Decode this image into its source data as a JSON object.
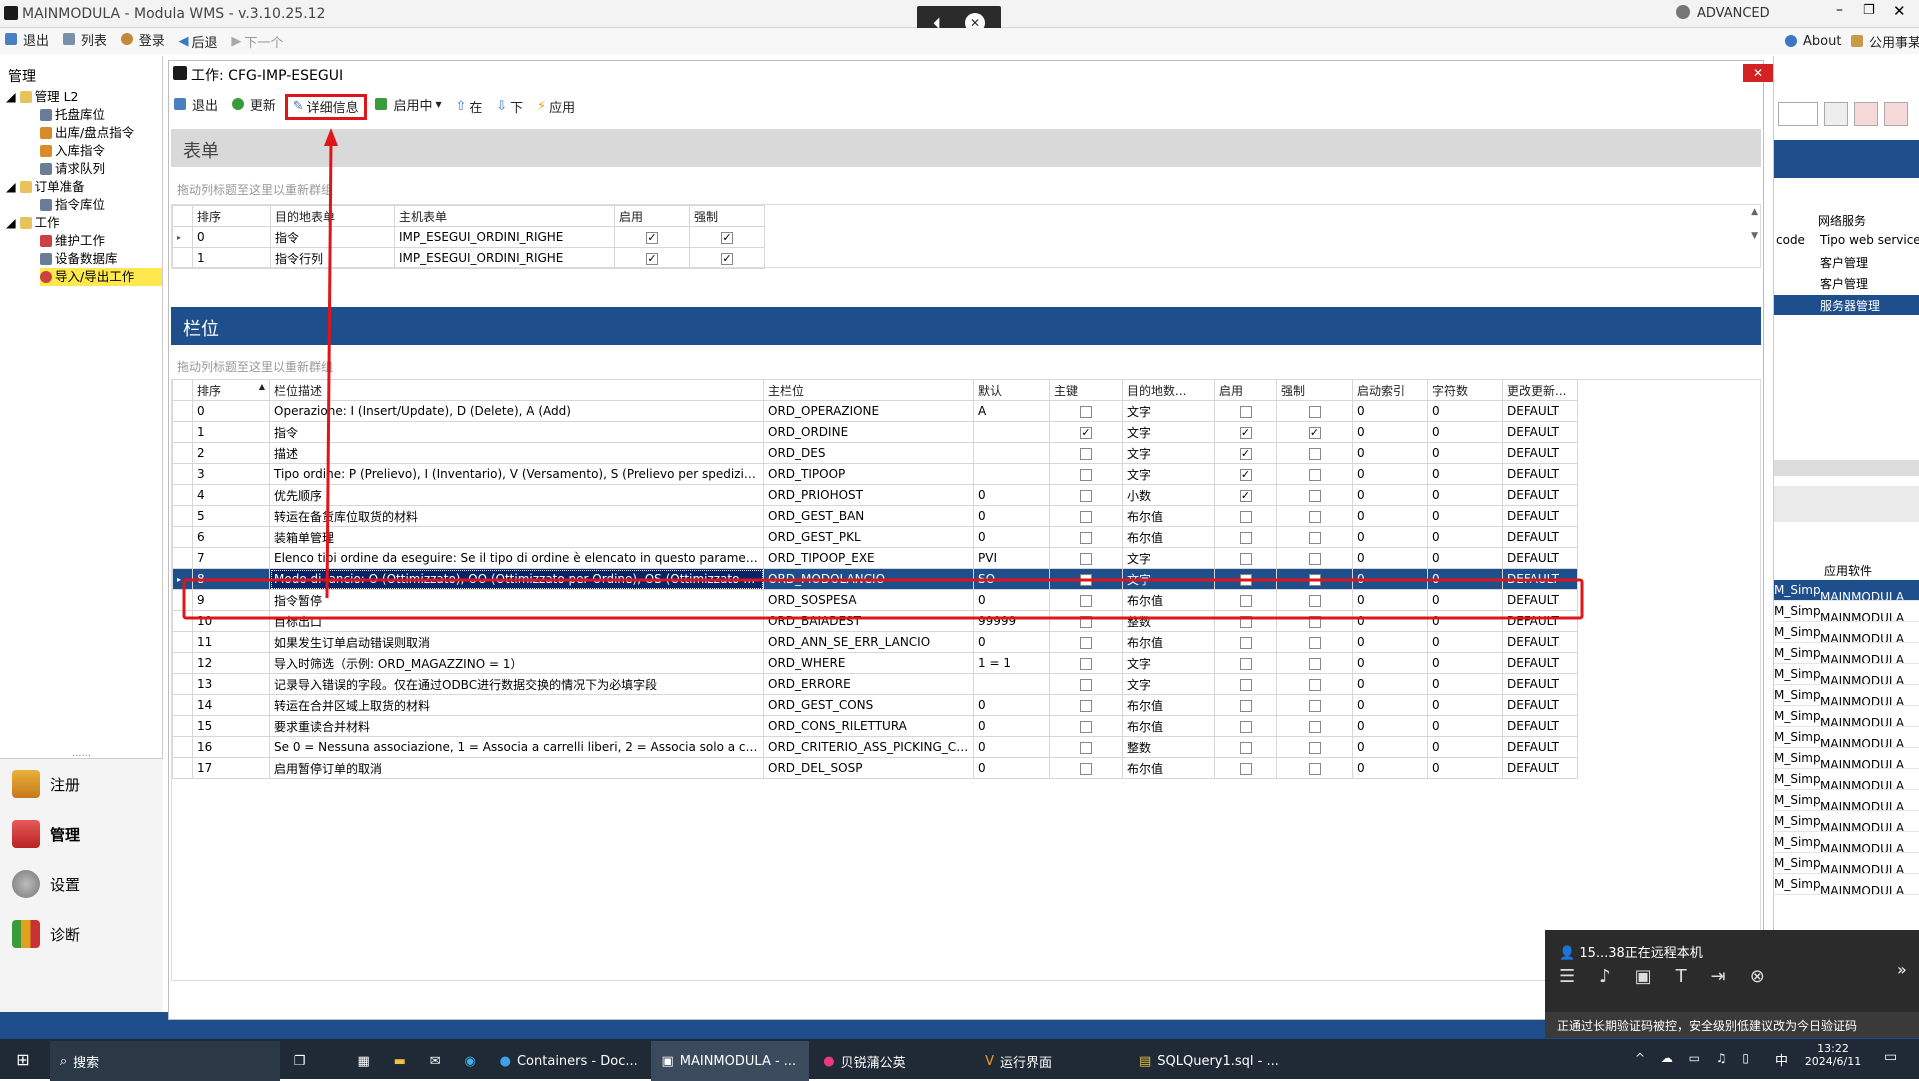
{
  "window": {
    "title": "MAINMODULA - Modula WMS - v.3.10.25.12",
    "user": "ADVANCED"
  },
  "toolbar": {
    "exit": "退出",
    "list": "列表",
    "login": "登录",
    "back": "后退",
    "next": "下一个",
    "about": "About",
    "common": "公用事某"
  },
  "left_panel": {
    "title": "管理",
    "tree": [
      {
        "label": "管理 L2",
        "level": 0
      },
      {
        "label": "托盘库位",
        "level": 1
      },
      {
        "label": "出库/盘点指令",
        "level": 1
      },
      {
        "label": "入库指令",
        "level": 1
      },
      {
        "label": "请求队列",
        "level": 1
      },
      {
        "label": "订单准备",
        "level": 0
      },
      {
        "label": "指令库位",
        "level": 1
      },
      {
        "label": "工作",
        "level": 0
      },
      {
        "label": "维护工作",
        "level": 1
      },
      {
        "label": "设备数据库",
        "level": 1
      },
      {
        "label": "导入/导出工作",
        "level": 1,
        "selected": true
      }
    ],
    "dots": "......",
    "nav": [
      "注册",
      "管理",
      "设置",
      "诊断"
    ]
  },
  "dialog": {
    "title": "工作: CFG-IMP-ESEGUI",
    "toolbar": {
      "exit": "退出",
      "refresh": "更新",
      "details": "详细信息",
      "enabled": "启用中",
      "up": "在",
      "down": "下",
      "apply": "应用"
    },
    "form_section": "表单",
    "group_hint": "拖动列标题至这里以重新群组",
    "form_table": {
      "columns": [
        "排序",
        "目的地表单",
        "主机表单",
        "启用",
        "强制"
      ],
      "rows": [
        {
          "order": "0",
          "dest": "指令",
          "host": "IMP_ESEGUI_ORDINI_RIGHE",
          "enabled": true,
          "forced": true
        },
        {
          "order": "1",
          "dest": "指令行列",
          "host": "IMP_ESEGUI_ORDINI_RIGHE",
          "enabled": true,
          "forced": true
        }
      ]
    },
    "fields_section": "栏位",
    "fields_table": {
      "columns": [
        "排序",
        "栏位描述",
        "主栏位",
        "默认",
        "主键",
        "目的地数...",
        "启用",
        "强制",
        "启动索引",
        "字符数",
        "更改更新..."
      ],
      "rows": [
        {
          "order": "0",
          "desc": "Operazione: I (Insert/Update), D (Delete), A (Add)",
          "field": "ORD_OPERAZIONE",
          "def": "A",
          "key": false,
          "type": "文字",
          "en": false,
          "force": false,
          "idx": "0",
          "chars": "0",
          "upd": "DEFAULT"
        },
        {
          "order": "1",
          "desc": "指令",
          "field": "ORD_ORDINE",
          "def": "",
          "key": true,
          "type": "文字",
          "en": true,
          "force": true,
          "idx": "0",
          "chars": "0",
          "upd": "DEFAULT"
        },
        {
          "order": "2",
          "desc": "描述",
          "field": "ORD_DES",
          "def": "",
          "key": false,
          "type": "文字",
          "en": true,
          "force": false,
          "idx": "0",
          "chars": "0",
          "upd": "DEFAULT"
        },
        {
          "order": "3",
          "desc": "Tipo ordine: P (Prelievo), I (Inventario), V (Versamento), S (Prelievo per spedizione), ...",
          "field": "ORD_TIPOOP",
          "def": "",
          "key": false,
          "type": "文字",
          "en": true,
          "force": false,
          "idx": "0",
          "chars": "0",
          "upd": "DEFAULT"
        },
        {
          "order": "4",
          "desc": "优先顺序",
          "field": "ORD_PRIOHOST",
          "def": "0",
          "key": false,
          "type": "小数",
          "en": true,
          "force": false,
          "idx": "0",
          "chars": "0",
          "upd": "DEFAULT"
        },
        {
          "order": "5",
          "desc": "转运在备货库位取货的材料",
          "field": "ORD_GEST_BAN",
          "def": "0",
          "key": false,
          "type": "布尔值",
          "en": false,
          "force": false,
          "idx": "0",
          "chars": "0",
          "upd": "DEFAULT"
        },
        {
          "order": "6",
          "desc": "装箱单管理",
          "field": "ORD_GEST_PKL",
          "def": "0",
          "key": false,
          "type": "布尔值",
          "en": false,
          "force": false,
          "idx": "0",
          "chars": "0",
          "upd": "DEFAULT"
        },
        {
          "order": "7",
          "desc": "Elenco tipi ordine da eseguire: Se il tipo di ordine è elencato in questo parametro la rig...",
          "field": "ORD_TIPOOP_EXE",
          "def": "PVI",
          "key": false,
          "type": "文字",
          "en": false,
          "force": false,
          "idx": "0",
          "chars": "0",
          "upd": "DEFAULT"
        },
        {
          "order": "8",
          "desc": "Modo di lancio: O (Ottimizzato), OO (Ottimizzato per Ordine), OS (Ottimizzato per spe...",
          "field": "ORD_MODOLANCIO",
          "def": "SO",
          "key": false,
          "type": "文字",
          "en": false,
          "force": false,
          "idx": "0",
          "chars": "0",
          "upd": "DEFAULT",
          "selected": true
        },
        {
          "order": "9",
          "desc": "指令暂停",
          "field": "ORD_SOSPESA",
          "def": "0",
          "key": false,
          "type": "布尔值",
          "en": false,
          "force": false,
          "idx": "0",
          "chars": "0",
          "upd": "DEFAULT"
        },
        {
          "order": "10",
          "desc": "目标出口",
          "field": "ORD_BAIADEST",
          "def": "99999",
          "key": false,
          "type": "整数",
          "en": false,
          "force": false,
          "idx": "0",
          "chars": "0",
          "upd": "DEFAULT"
        },
        {
          "order": "11",
          "desc": "如果发生订单启动错误则取消",
          "field": "ORD_ANN_SE_ERR_LANCIO",
          "def": "0",
          "key": false,
          "type": "布尔值",
          "en": false,
          "force": false,
          "idx": "0",
          "chars": "0",
          "upd": "DEFAULT"
        },
        {
          "order": "12",
          "desc": "导入时筛选（示例: ORD_MAGAZZINO = 1）",
          "field": "ORD_WHERE",
          "def": "1 = 1",
          "key": false,
          "type": "文字",
          "en": false,
          "force": false,
          "idx": "0",
          "chars": "0",
          "upd": "DEFAULT"
        },
        {
          "order": "13",
          "desc": "记录导入错误的字段。仅在通过ODBC进行数据交换的情况下为必填字段",
          "field": "ORD_ERRORE",
          "def": "",
          "key": false,
          "type": "文字",
          "en": false,
          "force": false,
          "idx": "0",
          "chars": "0",
          "upd": "DEFAULT"
        },
        {
          "order": "14",
          "desc": "转运在合并区域上取货的材料",
          "field": "ORD_GEST_CONS",
          "def": "0",
          "key": false,
          "type": "布尔值",
          "en": false,
          "force": false,
          "idx": "0",
          "chars": "0",
          "upd": "DEFAULT"
        },
        {
          "order": "15",
          "desc": "要求重读合并材料",
          "field": "ORD_CONS_RILETTURA",
          "def": "0",
          "key": false,
          "type": "布尔值",
          "en": false,
          "force": false,
          "idx": "0",
          "chars": "0",
          "upd": "DEFAULT"
        },
        {
          "order": "16",
          "desc": "Se 0 = Nessuna associazione, 1 = Associa a carrelli liberi, 2 = Associa solo a carrelli con ...",
          "field": "ORD_CRITERIO_ASS_PICKING_CART",
          "def": "0",
          "key": false,
          "type": "整数",
          "en": false,
          "force": false,
          "idx": "0",
          "chars": "0",
          "upd": "DEFAULT"
        },
        {
          "order": "17",
          "desc": "启用暂停订单的取消",
          "field": "ORD_DEL_SOSP",
          "def": "0",
          "key": false,
          "type": "布尔值",
          "en": false,
          "force": false,
          "idx": "0",
          "chars": "0",
          "upd": "DEFAULT"
        }
      ]
    }
  },
  "right_panel": {
    "header1": "网络服务",
    "col_code": "code",
    "col_tipo": "Tipo web service",
    "services": [
      "客户管理",
      "客户管理",
      "服务器管理"
    ],
    "header2": "应用软件",
    "apps": [
      {
        "a": "M_Simpl",
        "b": "MAINMODULA"
      },
      {
        "a": "M_Simpl",
        "b": "MAINMODULA"
      },
      {
        "a": "M_Simpl",
        "b": "MAINMODULA"
      },
      {
        "a": "M_Simpl",
        "b": "MAINMODULA"
      },
      {
        "a": "M_Simpl",
        "b": "MAINMODULA"
      },
      {
        "a": "M_Simpl",
        "b": "MAINMODULA"
      },
      {
        "a": "M_Simpl",
        "b": "MAINMODULA"
      },
      {
        "a": "M_Simpl",
        "b": "MAINMODULA"
      },
      {
        "a": "M_Simpl",
        "b": "MAINMODULA"
      },
      {
        "a": "M_Simpl",
        "b": "MAINMODULA"
      },
      {
        "a": "M_Simpl",
        "b": "MAINMODULA"
      },
      {
        "a": "M_Simpl",
        "b": "MAINMODULA"
      },
      {
        "a": "M_Simpl",
        "b": "MAINMODULA"
      },
      {
        "a": "M_Simpl",
        "b": "MAINMODULA"
      },
      {
        "a": "M_Simpl",
        "b": "MAINMODULA"
      }
    ]
  },
  "remote": {
    "status": "15...38正在远程本机",
    "warning": "正通过长期验证码被控，安全级别低建议改为今日验证码"
  },
  "taskbar": {
    "search": "搜索",
    "apps": [
      "Containers - Doc...",
      "MAINMODULA - ...",
      "贝锐蒲公英",
      "运行界面",
      "SQLQuery1.sql - ..."
    ],
    "time": "13:22",
    "date": "2024/6/11",
    "ime": "中"
  },
  "colors": {
    "accent_blue": "#1f4e8c",
    "highlight_red": "#e0151a",
    "tree_selected": "#ffe84d"
  }
}
